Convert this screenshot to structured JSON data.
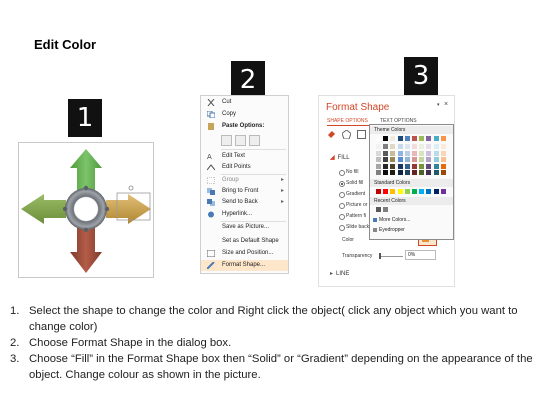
{
  "title": "Edit Color",
  "steps": [
    "1",
    "2",
    "3"
  ],
  "context_menu": {
    "items": [
      {
        "label": "Cut",
        "icon": "scissors-icon"
      },
      {
        "label": "Copy",
        "icon": "copy-icon"
      },
      {
        "label": "Paste Options:",
        "icon": "paste-icon"
      },
      {
        "label": "Edit Text",
        "icon": "edit-text-icon"
      },
      {
        "label": "Edit Points",
        "icon": "edit-points-icon"
      },
      {
        "label": "Group",
        "icon": "group-icon",
        "arrow": "▸"
      },
      {
        "label": "Bring to Front",
        "icon": "bring-front-icon",
        "arrow": "▸"
      },
      {
        "label": "Send to Back",
        "icon": "send-back-icon",
        "arrow": "▸"
      },
      {
        "label": "Hyperlink...",
        "icon": "hyperlink-icon"
      },
      {
        "label": "Save as Picture...",
        "icon": ""
      },
      {
        "label": "Set as Default Shape",
        "icon": ""
      },
      {
        "label": "Size and Position...",
        "icon": "size-position-icon"
      },
      {
        "label": "Format Shape...",
        "icon": "format-shape-icon"
      }
    ]
  },
  "format_pane": {
    "title": "Format Shape",
    "tab_shape": "SHAPE OPTIONS",
    "tab_text": "TEXT OPTIONS",
    "fill_header": "FILL",
    "fill_options": [
      "No fill",
      "Solid fill",
      "Gradient fill",
      "Picture or texture fill",
      "Pattern fill",
      "Slide background fill"
    ],
    "fill_options_visible": [
      "No fill",
      "Solid fill",
      "Gradient",
      "Picture or",
      "Pattern fi",
      "Slide back"
    ],
    "color_label": "Color",
    "transparency_label": "Transparency",
    "transparency_value": "0%",
    "line_header": "LINE",
    "close_glyph": "×",
    "dropdown_glyph": "▾"
  },
  "color_popup": {
    "theme_header": "Theme Colors",
    "standard_header": "Standard Colors",
    "recent_header": "Recent Colors",
    "more_colors": "More Colors...",
    "eyedropper": "Eyedropper",
    "theme_top": [
      "#ffffff",
      "#000000",
      "#eeece1",
      "#1f497d",
      "#4f81bd",
      "#c0504d",
      "#9bbb59",
      "#8064a2",
      "#4bacc6",
      "#f79646"
    ],
    "theme_shade_cols": [
      [
        "#f2f2f2",
        "#d9d9d9",
        "#bfbfbf",
        "#a6a6a6",
        "#808080"
      ],
      [
        "#7f7f7f",
        "#595959",
        "#404040",
        "#262626",
        "#0d0d0d"
      ],
      [
        "#ddd9c4",
        "#c4bd97",
        "#948a54",
        "#4a452a",
        "#1e1c11"
      ],
      [
        "#c6d9f1",
        "#8eb4e3",
        "#558ed5",
        "#17375e",
        "#0f243e"
      ],
      [
        "#dce6f2",
        "#b9cde5",
        "#95b3d7",
        "#376092",
        "#254061"
      ],
      [
        "#f2dcdb",
        "#e6b9b8",
        "#d99694",
        "#953735",
        "#632523"
      ],
      [
        "#ebf1de",
        "#d7e4bd",
        "#c3d69b",
        "#77933c",
        "#4f6228"
      ],
      [
        "#e6e0ec",
        "#ccc1da",
        "#b3a2c7",
        "#604a7b",
        "#403152"
      ],
      [
        "#dbeef4",
        "#b7dee8",
        "#93cddd",
        "#31859c",
        "#215968"
      ],
      [
        "#fdeada",
        "#fcd5b5",
        "#fac090",
        "#e46c0a",
        "#984807"
      ]
    ],
    "standard": [
      "#c00000",
      "#ff0000",
      "#ffc000",
      "#ffff00",
      "#92d050",
      "#00b050",
      "#00b0f0",
      "#0070c0",
      "#002060",
      "#7030a0"
    ],
    "recent": [
      "#595959",
      "#7f7f7f"
    ]
  },
  "diagram": {
    "arrow_colors": {
      "up": "#5fa54a",
      "left": "#7fa04a",
      "right": "#c8a048",
      "down": "#9a4a3a",
      "ring": "#8a8f96"
    }
  },
  "instructions": [
    {
      "n": "1.",
      "text": "Select the shape to change the color and Right click the object( click any object which you want to change color)"
    },
    {
      "n": "2.",
      "text": "Choose Format Shape in the dialog box."
    },
    {
      "n": "3.",
      "text": "Choose “Fill” in the Format Shape box then “Solid” or “Gradient” depending on the appearance of the object. Change colour as shown in the picture."
    }
  ]
}
